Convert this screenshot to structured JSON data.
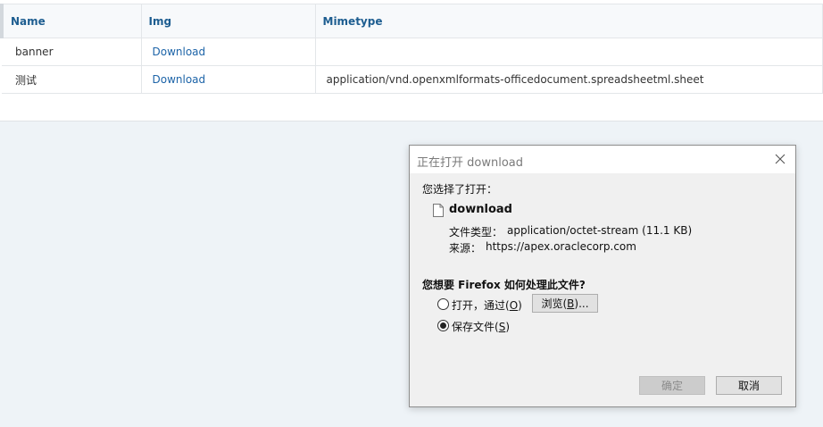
{
  "report": {
    "columns": [
      "Name",
      "Img",
      "Mimetype"
    ],
    "rows": [
      {
        "name": "banner",
        "img": "Download",
        "mimetype": ""
      },
      {
        "name": "测试",
        "img": "Download",
        "mimetype": "application/vnd.openxmlformats-officedocument.spreadsheetml.sheet"
      }
    ]
  },
  "dialog": {
    "title": "正在打开 download",
    "intro": "您选择了打开：",
    "file_name": "download",
    "file_type_label": "文件类型：",
    "file_type_value": "application/octet-stream (11.1 KB)",
    "source_label": "来源：",
    "source_value": "https://apex.oraclecorp.com",
    "question": "您想要 Firefox 如何处理此文件?",
    "open_with_label": "打开，通过(",
    "open_with_key": "O",
    "open_with_suffix": ")",
    "browse_label": "浏览(",
    "browse_key": "B",
    "browse_suffix": ")...",
    "save_label": "保存文件(",
    "save_key": "S",
    "save_suffix": ")",
    "selected_option": "save",
    "ok_label": "确定",
    "cancel_label": "取消"
  },
  "icons": {
    "close": "close-icon",
    "file": "file-icon"
  },
  "colors": {
    "header_text": "#1d5d90",
    "link": "#1d64a8",
    "page_bg": "#eef3f7"
  }
}
